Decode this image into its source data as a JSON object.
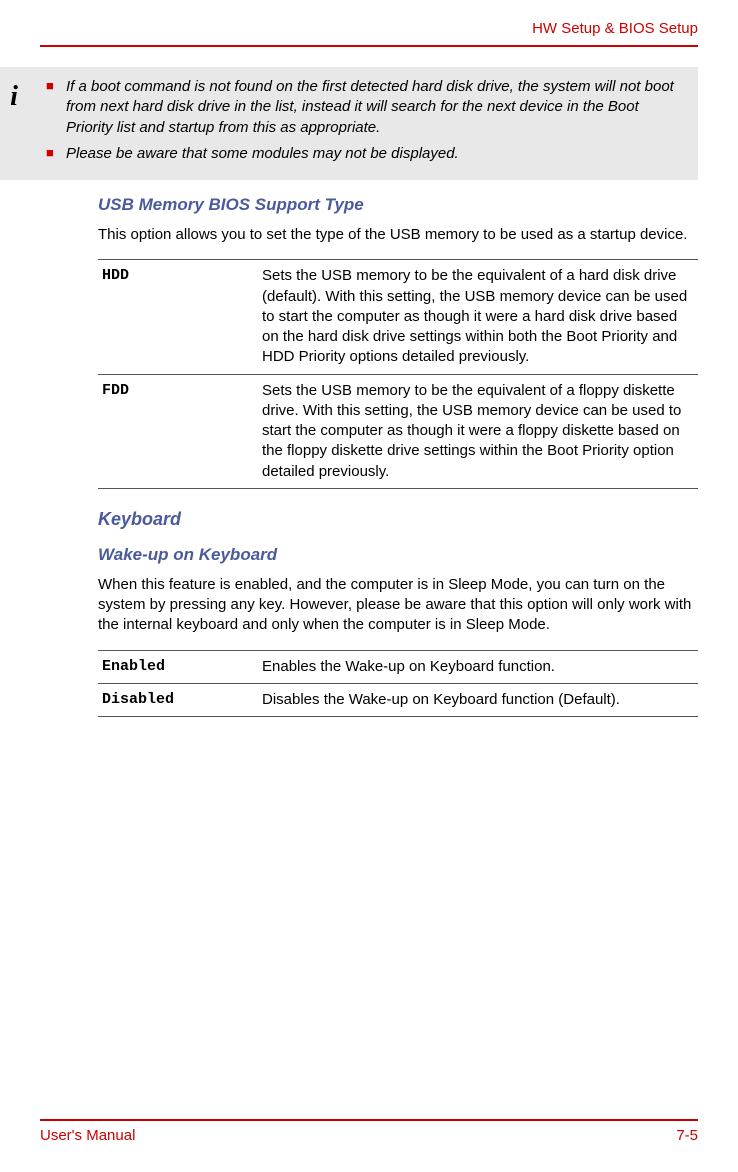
{
  "header": {
    "title": "HW Setup & BIOS Setup"
  },
  "info_box": {
    "items": [
      "If a boot command is not found on the first detected hard disk drive, the system will not boot from next hard disk drive in the list, instead it will search for the next device in the Boot Priority list and startup from this as appropriate.",
      "Please be aware that some modules may not be displayed."
    ]
  },
  "section_usb": {
    "subtitle": "USB Memory BIOS Support Type",
    "intro": "This option allows you to set the type of the USB memory to be used as a startup device.",
    "options": [
      {
        "label": "HDD",
        "description": "Sets the USB memory to be the equivalent of a hard disk drive (default). With this setting, the USB memory device can be used to start the computer as though it were a hard disk drive based on the hard disk drive settings within both the Boot Priority and HDD Priority options detailed previously."
      },
      {
        "label": "FDD",
        "description": "Sets the USB memory to be the equivalent of a floppy diskette drive. With this setting, the USB memory device can be used to start the computer as though it were a floppy diskette based on the floppy diskette drive settings within the Boot Priority option detailed previously."
      }
    ]
  },
  "section_keyboard": {
    "title": "Keyboard",
    "subtitle": "Wake-up on Keyboard",
    "intro": "When this feature is enabled, and the computer is in Sleep Mode, you can turn on the system by pressing any key. However, please be aware that this option will only work with the internal keyboard and only when the computer is in Sleep Mode.",
    "options": [
      {
        "label": "Enabled",
        "description": "Enables the Wake-up on Keyboard function."
      },
      {
        "label": "Disabled",
        "description": "Disables the Wake-up on Keyboard function (Default)."
      }
    ]
  },
  "footer": {
    "left": "User's Manual",
    "right": "7-5"
  }
}
